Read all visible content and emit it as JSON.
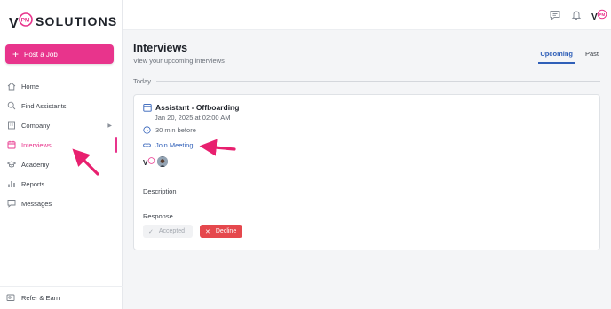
{
  "brand": {
    "logo_mark": "VPM",
    "name": "SOLUTIONS",
    "accent": "#e8348c",
    "link": "#2f5fb8"
  },
  "sidebar": {
    "post_job_label": "Post a Job",
    "items": [
      {
        "label": "Home",
        "icon": "home-icon"
      },
      {
        "label": "Find Assistants",
        "icon": "search-icon"
      },
      {
        "label": "Company",
        "icon": "building-icon"
      },
      {
        "label": "Interviews",
        "icon": "calendar-icon"
      },
      {
        "label": "Academy",
        "icon": "graduation-cap-icon"
      },
      {
        "label": "Reports",
        "icon": "bar-chart-icon"
      },
      {
        "label": "Messages",
        "icon": "chat-icon"
      }
    ],
    "refer_label": "Refer & Earn"
  },
  "topbar": {
    "icons": [
      "message-icon",
      "bell-icon",
      "avatar-logo-icon"
    ]
  },
  "page": {
    "title": "Interviews",
    "subtitle": "View your upcoming interviews",
    "tabs": [
      {
        "label": "Upcoming"
      },
      {
        "label": "Past"
      }
    ],
    "group_label": "Today"
  },
  "interview": {
    "title": "Assistant - Offboarding",
    "datetime": "Jan 20, 2025 at 02:00 AM",
    "reminder": "30 min before",
    "join_label": "Join Meeting",
    "description_label": "Description",
    "response_label": "Response",
    "accepted_label": "Accepted",
    "decline_label": "Decline"
  }
}
